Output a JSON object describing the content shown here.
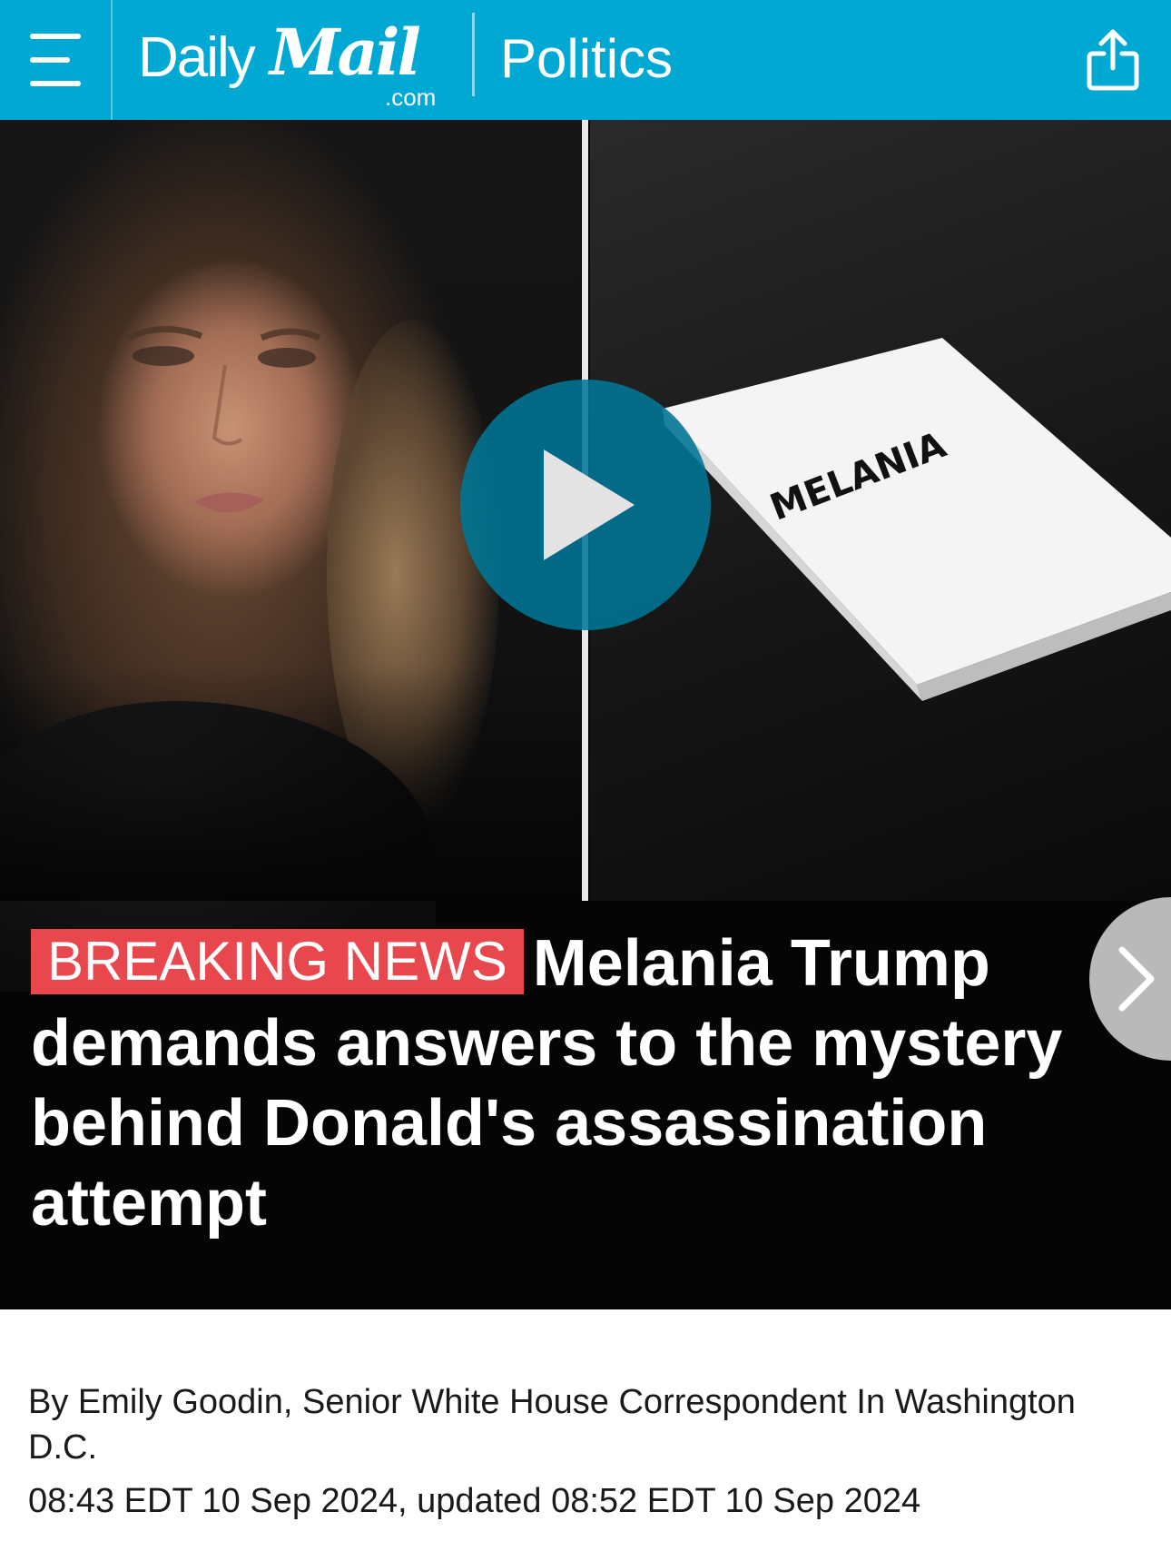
{
  "header": {
    "menu_icon": "hamburger-menu-icon",
    "logo": {
      "daily": "Daily",
      "mail": "Mail",
      "com": ".com"
    },
    "section": "Politics",
    "share_icon": "share-icon",
    "background_color": "#00a9d4"
  },
  "hero": {
    "book_title": "MELANIA",
    "play_icon": "play-icon",
    "next_icon": "chevron-right-icon",
    "badge": "BREAKING NEWS",
    "badge_color": "#e8474d",
    "headline": "Melania Trump demands answers to the mystery behind Donald's assassination attempt"
  },
  "article": {
    "byline": "By Emily Goodin, Senior White House Correspondent In Washington D.C.",
    "timestamp": "08:43 EDT 10 Sep 2024, updated 08:52 EDT 10 Sep 2024"
  }
}
